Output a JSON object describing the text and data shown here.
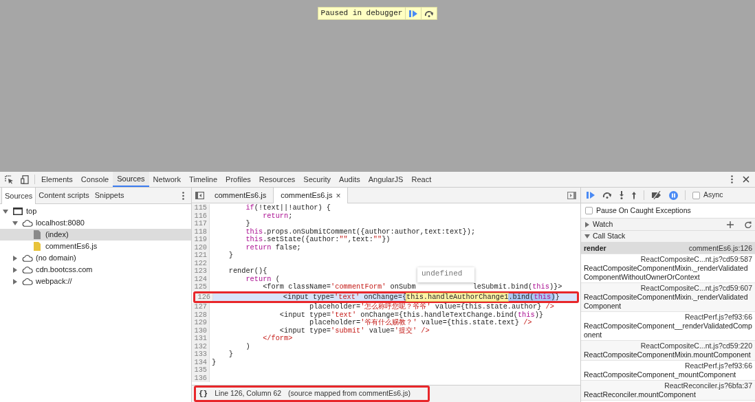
{
  "page_overlay": {
    "message": "Paused in debugger"
  },
  "main_tabs": [
    {
      "label": "Elements",
      "selected": false
    },
    {
      "label": "Console",
      "selected": false
    },
    {
      "label": "Sources",
      "selected": true
    },
    {
      "label": "Network",
      "selected": false
    },
    {
      "label": "Timeline",
      "selected": false
    },
    {
      "label": "Profiles",
      "selected": false
    },
    {
      "label": "Resources",
      "selected": false
    },
    {
      "label": "Security",
      "selected": false
    },
    {
      "label": "Audits",
      "selected": false
    },
    {
      "label": "AngularJS",
      "selected": false
    },
    {
      "label": "React",
      "selected": false
    }
  ],
  "navigator": {
    "tabs": [
      {
        "label": "Sources",
        "selected": true
      },
      {
        "label": "Content scripts",
        "selected": false
      },
      {
        "label": "Snippets",
        "selected": false
      }
    ],
    "tree": [
      {
        "label": "top",
        "kind": "frame",
        "expanded": true,
        "selected": false,
        "children": [
          {
            "label": "localhost:8080",
            "kind": "domain",
            "expanded": true,
            "selected": false,
            "children": [
              {
                "label": "(index)",
                "kind": "file",
                "selected": true
              },
              {
                "label": "commentEs6.js",
                "kind": "script",
                "selected": false
              }
            ]
          },
          {
            "label": "(no domain)",
            "kind": "domain",
            "expanded": false,
            "selected": false
          },
          {
            "label": "cdn.bootcss.com",
            "kind": "domain",
            "expanded": false,
            "selected": false
          },
          {
            "label": "webpack://",
            "kind": "domain",
            "expanded": false,
            "selected": false
          }
        ]
      }
    ]
  },
  "editor": {
    "tabs": [
      {
        "label": "commentEs6.js",
        "selected": false
      },
      {
        "label": "commentEs6.js",
        "selected": true,
        "close": "×"
      }
    ],
    "lines": [
      {
        "number": "115",
        "current": false,
        "tokens": [
          {
            "kind": "keyword",
            "text": "        if"
          },
          {
            "kind": "plain",
            "text": "(!text||!author) {"
          }
        ]
      },
      {
        "number": "116",
        "current": false,
        "tokens": [
          {
            "kind": "keyword",
            "text": "            return"
          },
          {
            "kind": "plain",
            "text": ";"
          }
        ]
      },
      {
        "number": "117",
        "current": false,
        "tokens": [
          {
            "kind": "plain",
            "text": "        }"
          }
        ]
      },
      {
        "number": "118",
        "current": false,
        "tokens": [
          {
            "kind": "keyword",
            "text": "        this"
          },
          {
            "kind": "plain",
            "text": ".props.onSubmitComment({author:author,text:text});"
          }
        ]
      },
      {
        "number": "119",
        "current": false,
        "tokens": [
          {
            "kind": "keyword",
            "text": "        this"
          },
          {
            "kind": "plain",
            "text": ".setState({author:"
          },
          {
            "kind": "string",
            "text": "\"\""
          },
          {
            "kind": "plain",
            "text": ",text:"
          },
          {
            "kind": "string",
            "text": "\"\""
          },
          {
            "kind": "plain",
            "text": "})"
          }
        ]
      },
      {
        "number": "120",
        "current": false,
        "tokens": [
          {
            "kind": "keyword",
            "text": "        return"
          },
          {
            "kind": "plain",
            "text": " false;"
          }
        ]
      },
      {
        "number": "121",
        "current": false,
        "tokens": [
          {
            "kind": "plain",
            "text": "    }"
          }
        ]
      },
      {
        "number": "122",
        "current": false
      },
      {
        "number": "123",
        "current": false,
        "tokens": [
          {
            "kind": "plain",
            "text": "    render(){"
          }
        ]
      },
      {
        "number": "124",
        "current": false,
        "tokens": [
          {
            "kind": "keyword",
            "text": "        return"
          },
          {
            "kind": "plain",
            "text": " ("
          }
        ]
      },
      {
        "number": "125",
        "current": false,
        "tokens": [
          {
            "kind": "plain",
            "text": "            <form className="
          },
          {
            "kind": "string",
            "text": "'commentForm'"
          },
          {
            "kind": "plain",
            "text": " onSubm"
          },
          {
            "kind": "hidden"
          },
          {
            "kind": "plain",
            "text": "leSubmit.bind("
          },
          {
            "kind": "keyword",
            "text": "this"
          },
          {
            "kind": "plain",
            "text": ")}>"
          }
        ]
      },
      {
        "number": "126",
        "current": true,
        "tokens": [
          {
            "kind": "plain",
            "text": "                <input type=",
            "selected": false
          },
          {
            "kind": "string",
            "text": "'text'",
            "selected": false
          },
          {
            "kind": "plain",
            "text": " onChange={",
            "selected": false
          },
          {
            "kind": "evaluated",
            "text": "this.handleAuthorChange1",
            "selected": false
          },
          {
            "kind": "plain",
            "text": ".bind(",
            "selected": true
          },
          {
            "kind": "keyword",
            "text": "this",
            "selected": true
          },
          {
            "kind": "plain",
            "text": ")",
            "selected": true
          },
          {
            "kind": "plain",
            "text": "}",
            "selected": false
          }
        ]
      },
      {
        "number": "127",
        "current": false,
        "tokens": [
          {
            "kind": "plain",
            "text": "                       placeholder="
          },
          {
            "kind": "string",
            "text": "'怎么称呼您呢？爷爷'"
          },
          {
            "kind": "plain",
            "text": " value={this.state.author} "
          },
          {
            "kind": "string",
            "text": "/>"
          }
        ]
      },
      {
        "number": "128",
        "current": false,
        "tokens": [
          {
            "kind": "plain",
            "text": "                <input type="
          },
          {
            "kind": "string",
            "text": "'text'"
          },
          {
            "kind": "plain",
            "text": " onChange={this.handleTextChange.bind("
          },
          {
            "kind": "keyword",
            "text": "this"
          },
          {
            "kind": "plain",
            "text": ")}"
          }
        ]
      },
      {
        "number": "129",
        "current": false,
        "tokens": [
          {
            "kind": "plain",
            "text": "                       placeholder="
          },
          {
            "kind": "string",
            "text": "'爷有什么赐教？'"
          },
          {
            "kind": "plain",
            "text": " value={this.state.text} "
          },
          {
            "kind": "string",
            "text": "/>"
          }
        ]
      },
      {
        "number": "130",
        "current": false,
        "tokens": [
          {
            "kind": "plain",
            "text": "                <input type="
          },
          {
            "kind": "string",
            "text": "'submit'"
          },
          {
            "kind": "plain",
            "text": " value="
          },
          {
            "kind": "string",
            "text": "'提交'"
          },
          {
            "kind": "string",
            "text": " />"
          }
        ]
      },
      {
        "number": "131",
        "current": false,
        "tokens": [
          {
            "kind": "string",
            "text": "            </form>"
          }
        ]
      },
      {
        "number": "132",
        "current": false,
        "tokens": [
          {
            "kind": "plain",
            "text": "        )"
          }
        ]
      },
      {
        "number": "133",
        "current": false,
        "tokens": [
          {
            "kind": "plain",
            "text": "    }"
          }
        ]
      },
      {
        "number": "134",
        "current": false,
        "tokens": [
          {
            "kind": "plain",
            "text": "}"
          }
        ]
      },
      {
        "number": "135",
        "current": false
      },
      {
        "number": "136",
        "current": false
      }
    ],
    "popover": {
      "value": "undefined"
    },
    "status_bar": {
      "pretty_print": "{}",
      "position": "Line 126, Column 62",
      "source_map": "(source mapped from commentEs6.js)"
    }
  },
  "debugger": {
    "async": {
      "label": "Async",
      "checked": false
    },
    "pause_on_caught": {
      "label": "Pause On Caught Exceptions",
      "checked": false
    },
    "watch": {
      "title": "Watch",
      "expanded": false
    },
    "call_stack": {
      "title": "Call Stack",
      "expanded": true,
      "frames": [
        {
          "function": "render",
          "location": "commentEs6.js:126",
          "selected": true
        },
        {
          "function": "ReactCompositeComponentMixin._renderValidatedComponentWithoutOwnerOrContext",
          "location": "ReactCompositeC...nt.js?cd59:587",
          "selected": false
        },
        {
          "function": "ReactCompositeComponentMixin._renderValidatedComponent",
          "location": "ReactCompositeC...nt.js?cd59:607",
          "selected": false
        },
        {
          "function": "ReactCompositeComponent__renderValidatedComponent",
          "location": "ReactPerf.js?ef93:66",
          "selected": false
        },
        {
          "function": "ReactCompositeComponentMixin.mountComponent",
          "location": "ReactCompositeC...nt.js?cd59:220",
          "selected": false
        },
        {
          "function": "ReactCompositeComponent_mountComponent",
          "location": "ReactPerf.js?ef93:66",
          "selected": false
        },
        {
          "function": "ReactReconciler.mountComponent",
          "location": "ReactReconciler.js?6bfa:37",
          "selected": false
        }
      ]
    }
  }
}
